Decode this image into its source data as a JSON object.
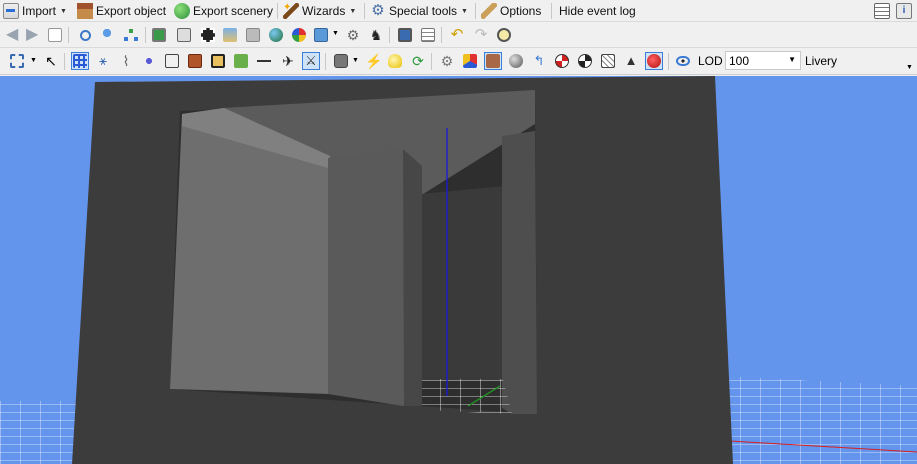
{
  "menubar": {
    "import_label": "Import",
    "export_object_label": "Export object",
    "export_scenery_label": "Export scenery",
    "wizards_label": "Wizards",
    "special_tools_label": "Special tools",
    "options_label": "Options",
    "hide_event_log_label": "Hide event log"
  },
  "toolbar2": {
    "lod_label": "LOD",
    "lod_value": "100",
    "livery_label": "Livery"
  },
  "colors": {
    "sky": "#6495ed",
    "wall": "#3a3a3a",
    "grid": "#ffffff",
    "axis_y": "#1a1ad6",
    "axis_x": "#d62020",
    "axis_z": "#20a020",
    "selected_button_border": "#3a7fd5"
  }
}
